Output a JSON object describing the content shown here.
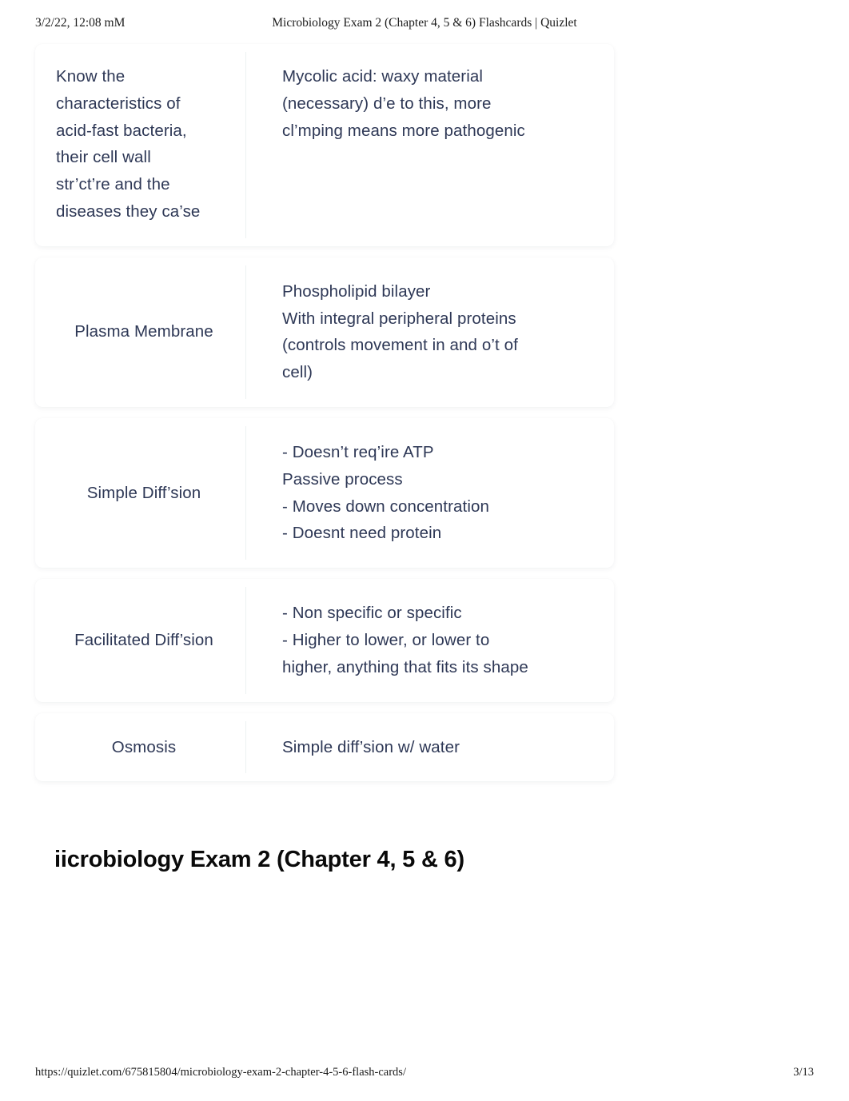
{
  "print_header": {
    "date": "3/2/22, 12:08 mM",
    "title": "Microbiology Exam 2 (Chapter 4, 5 & 6) Flashcards | Quizlet"
  },
  "set_title": "iicrobiology Exam 2 (Chapter 4, 5 & 6)",
  "cards": [
    {
      "term": "Know the\ncharacteristics of\nacid-fast bacteria,\ntheir cell wall\nstr’ct’re and the\ndiseases they ca’se",
      "definition": "Mycolic acid: waxy material\n(necessary) d’e to this, more\ncl’mping means more pathogenic"
    },
    {
      "term": "Plasma Membrane",
      "definition": "Phospholipid bilayer\nWith integral peripheral proteins\n(controls movement in and o’t of\ncell)"
    },
    {
      "term": "Simple Diff’sion",
      "definition": "- Doesn’t req’ire ATP\nPassive process\n- Moves down concentration\n- Doesnt need protein"
    },
    {
      "term": "Facilitated Diff’sion",
      "definition": "- Non specific or specific\n- Higher to lower, or lower to\nhigher, anything that fits its shape"
    },
    {
      "term": "Osmosis",
      "definition": "Simple diff’sion w/ water"
    }
  ],
  "print_footer": {
    "url": "https://quizlet.com/675815804/microbiology-exam-2-chapter-4-5-6-flash-cards/",
    "page": "3/13"
  },
  "colors": {
    "text": "#2e3856",
    "page_background": "#ffffff",
    "card_background": "#ffffff",
    "divider": "#edf1f2",
    "print_chrome_text": "#1c1c1c"
  }
}
